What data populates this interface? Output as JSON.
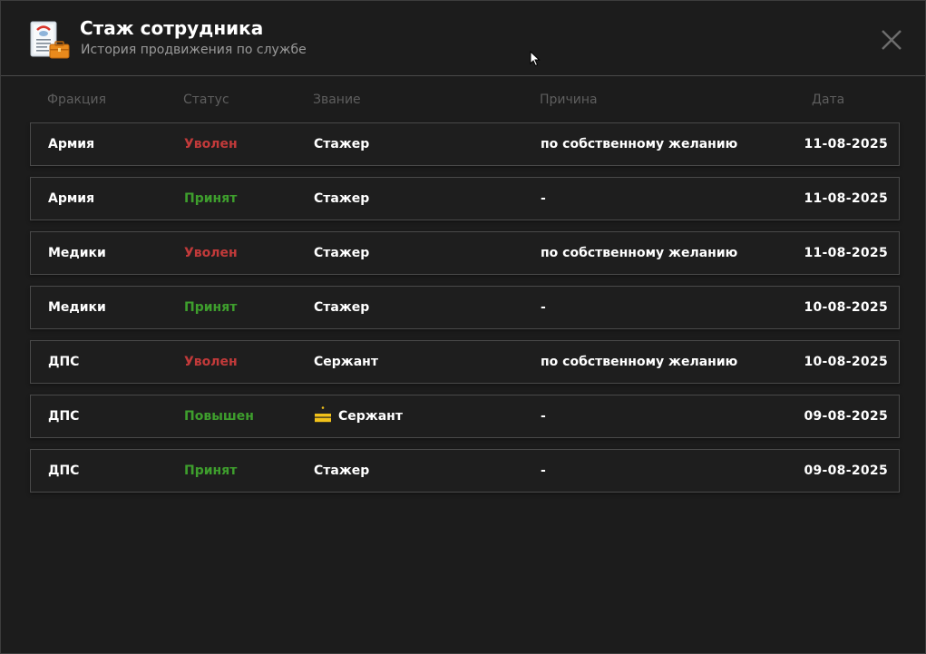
{
  "header": {
    "title": "Стаж сотрудника",
    "subtitle": "История продвижения по службе"
  },
  "columns": {
    "faction": "Фракция",
    "status": "Статус",
    "rank": "Звание",
    "reason": "Причина",
    "date": "Дата"
  },
  "colors": {
    "fired": "#c23a3a",
    "hired": "#3e9e2d",
    "promoted": "#3e9e2d",
    "accent_orange": "#e98a1c"
  },
  "rows": [
    {
      "faction": "Армия",
      "status": "Уволен",
      "status_kind": "fired",
      "rank": "Стажер",
      "rank_icon": "",
      "reason": "по собственному желанию",
      "date": "11-08-2025"
    },
    {
      "faction": "Армия",
      "status": "Принят",
      "status_kind": "hired",
      "rank": "Стажер",
      "rank_icon": "",
      "reason": "-",
      "date": "11-08-2025"
    },
    {
      "faction": "Медики",
      "status": "Уволен",
      "status_kind": "fired",
      "rank": "Стажер",
      "rank_icon": "",
      "reason": "по собственному желанию",
      "date": "11-08-2025"
    },
    {
      "faction": "Медики",
      "status": "Принят",
      "status_kind": "hired",
      "rank": "Стажер",
      "rank_icon": "",
      "reason": "-",
      "date": "10-08-2025"
    },
    {
      "faction": "ДПС",
      "status": "Уволен",
      "status_kind": "fired",
      "rank": "Сержант",
      "rank_icon": "",
      "reason": "по собственному желанию",
      "date": "10-08-2025"
    },
    {
      "faction": "ДПС",
      "status": "Повышен",
      "status_kind": "promoted",
      "rank": "Сержант",
      "rank_icon": "sergeant-insignia-icon",
      "reason": "-",
      "date": "09-08-2025"
    },
    {
      "faction": "ДПС",
      "status": "Принят",
      "status_kind": "hired",
      "rank": "Стажер",
      "rank_icon": "",
      "reason": "-",
      "date": "09-08-2025"
    }
  ]
}
